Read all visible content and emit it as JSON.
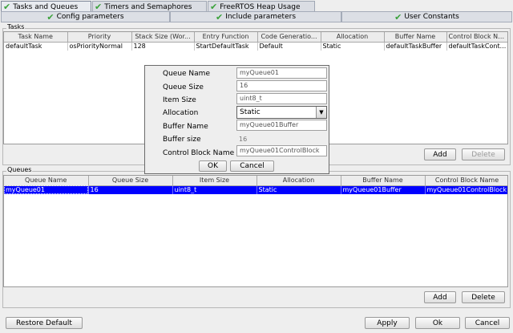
{
  "tabs": [
    {
      "label": "Tasks and Queues",
      "checked": true,
      "active": true
    },
    {
      "label": "Timers and Semaphores",
      "checked": true,
      "active": false
    },
    {
      "label": "FreeRTOS Heap Usage",
      "checked": true,
      "active": false
    }
  ],
  "subtabs": [
    {
      "label": "Config parameters",
      "checked": true
    },
    {
      "label": "Include parameters",
      "checked": true
    },
    {
      "label": "User Constants",
      "checked": true
    }
  ],
  "tasks": {
    "title": "Tasks",
    "columns": [
      "Task Name",
      "Priority",
      "Stack Size (Wor...",
      "Entry Function",
      "Code Generatio...",
      "Allocation",
      "Buffer Name",
      "Control Block Na..."
    ],
    "rows": [
      [
        "defaultTask",
        "osPriorityNormal",
        "128",
        "StartDefaultTask",
        "Default",
        "Static",
        "defaultTaskBuffer",
        "defaultTaskCont..."
      ]
    ],
    "add_label": "Add",
    "delete_label": "Delete"
  },
  "queues": {
    "title": "Queues",
    "columns": [
      "Queue Name",
      "Queue Size",
      "Item Size",
      "Allocation",
      "Buffer Name",
      "Control Block Name"
    ],
    "rows": [
      [
        "myQueue01",
        "16",
        "uint8_t",
        "Static",
        "myQueue01Buffer",
        "myQueue01ControlBlock"
      ]
    ],
    "add_label": "Add",
    "delete_label": "Delete"
  },
  "dialog": {
    "queue_name_label": "Queue Name",
    "queue_name": "myQueue01",
    "queue_size_label": "Queue Size",
    "queue_size": "16",
    "item_size_label": "Item Size",
    "item_size": "uint8_t",
    "allocation_label": "Allocation",
    "allocation": "Static",
    "buffer_name_label": "Buffer Name",
    "buffer_name": "myQueue01Buffer",
    "buffer_size_label": "Buffer size",
    "buffer_size": "16",
    "control_block_label": "Control Block Name",
    "control_block": "myQueue01ControlBlock",
    "ok_label": "OK",
    "cancel_label": "Cancel"
  },
  "footer": {
    "restore_label": "Restore Default",
    "apply_label": "Apply",
    "ok_label": "Ok",
    "cancel_label": "Cancel"
  },
  "icons": {
    "check": "check-icon",
    "dropdown": "chevron-down-icon"
  },
  "colors": {
    "selection": "#0000ff",
    "check": "#3aa23a"
  }
}
